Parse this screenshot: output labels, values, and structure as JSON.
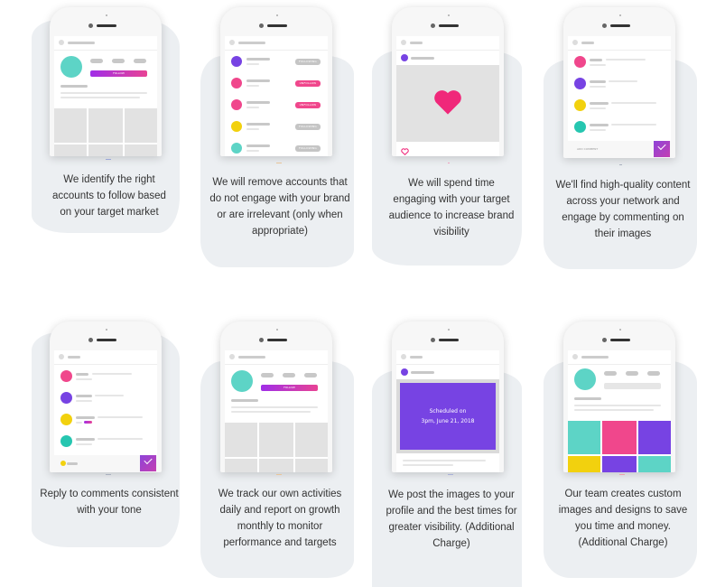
{
  "colors": {
    "blob_bg": "#eceff2",
    "teal": "#5dd4c6",
    "pink": "#f0478c",
    "purple": "#7743e3",
    "yellow": "#f2d10e",
    "heart": "#f0287a",
    "gray_badge": "#c5c5c5",
    "text": "#333333"
  },
  "cards": [
    {
      "id": "identify-accounts",
      "mockup": "profile",
      "follow_label": "FOLLOW",
      "caption": "We identify the right accounts to follow based on your target market"
    },
    {
      "id": "remove-accounts",
      "mockup": "following-list",
      "rows": [
        {
          "avatar_color": "purple",
          "badge": "FOLLOWING"
        },
        {
          "avatar_color": "pink",
          "badge": "UNFOLLOW"
        },
        {
          "avatar_color": "pink",
          "badge": "UNFOLLOW"
        },
        {
          "avatar_color": "yellow",
          "badge": "FOLLOWING"
        },
        {
          "avatar_color": "teal",
          "badge": "FOLLOWING"
        }
      ],
      "caption": "We will remove accounts that do not engage with your brand or are irrelevant (only when appropriate)"
    },
    {
      "id": "engage-audience",
      "mockup": "liked-post",
      "caption": "We will spend time engaging with your target audience to increase brand visibility"
    },
    {
      "id": "find-content",
      "mockup": "comments",
      "comment_placeholder": "ADD COMMENT",
      "rows": [
        "pink",
        "purple",
        "yellow",
        "teal"
      ],
      "caption": "We'll find high-quality content across your network and engage by commenting on their images"
    },
    {
      "id": "reply-comments",
      "mockup": "comments-reply",
      "rows": [
        "pink",
        "purple",
        "yellow",
        "teal"
      ],
      "caption": "Reply to comments consistent with your tone"
    },
    {
      "id": "track-report",
      "mockup": "profile",
      "follow_label": "FOLLOW",
      "caption": "We track our own activities daily and report on growth monthly to monitor performance and targets"
    },
    {
      "id": "post-images",
      "mockup": "scheduled-post",
      "scheduled_line1": "Scheduled on",
      "scheduled_line2": "3pm, June 21, 2018",
      "caption": "We post the images to your profile and the best times for greater visibility. (Additional Charge)"
    },
    {
      "id": "custom-designs",
      "mockup": "profile-colored-grid",
      "grid_colors": [
        "teal",
        "pink",
        "purple",
        "yellow",
        "purple",
        "teal"
      ],
      "caption": "Our team creates custom images and designs to save you time and money. (Additional Charge)"
    }
  ]
}
